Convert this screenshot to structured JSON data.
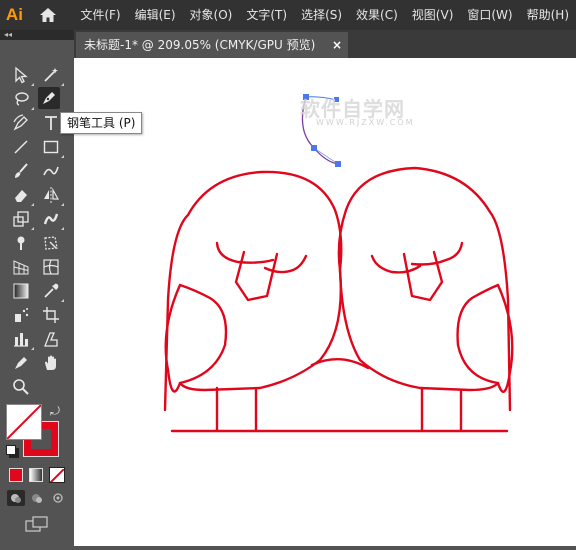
{
  "app": {
    "logo": "Ai"
  },
  "menu": [
    "文件(F)",
    "编辑(E)",
    "对象(O)",
    "文字(T)",
    "选择(S)",
    "效果(C)",
    "视图(V)",
    "窗口(W)",
    "帮助(H)"
  ],
  "document_tab": {
    "title": "未标题-1* @ 209.05% (CMYK/GPU 预览)",
    "close": "×"
  },
  "panel_collapse": "◂◂",
  "tooltip": "钢笔工具 (P)",
  "watermark": {
    "main": "软件自学网",
    "sub": "WWW.RJZXW.COM"
  },
  "colors": {
    "stroke": "#e0061b",
    "anchor": "#4a78e8",
    "path_preview": "#7a3fa0",
    "menubar": "#323232",
    "toolbox": "#535353"
  },
  "tools": [
    "selection-tool",
    "direct-selection-tool",
    "magic-wand-tool",
    "lasso-tool",
    "pen-tool",
    "curvature-tool",
    "type-tool",
    "line-segment-tool",
    "rectangle-tool",
    "paintbrush-tool",
    "shaper-tool",
    "eraser-tool",
    "reflect-tool",
    "scale-tool",
    "warp-tool",
    "puppet-warp-tool",
    "free-transform-tool",
    "perspective-grid-tool",
    "mesh-tool",
    "gradient-tool",
    "eyedropper-tool",
    "symbol-sprayer-tool",
    "artboard-tool",
    "column-graph-tool",
    "slice-tool",
    "hand-tool",
    "zoom-tool"
  ]
}
